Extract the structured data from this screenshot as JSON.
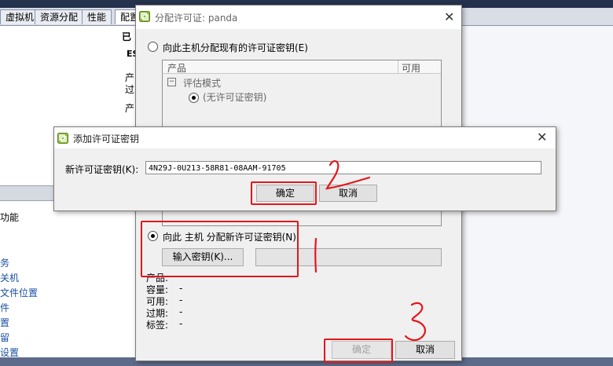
{
  "background": {
    "tabs": [
      "虚拟机",
      "资源分配",
      "性能",
      "配置"
    ],
    "right_header": "已",
    "frag_es": "ES",
    "frag_p1": "产",
    "frag_p2": "过",
    "frag_p3": "产",
    "left_heading": "功能",
    "left_links": [
      "务",
      "关机",
      "文件位置",
      "件",
      "置",
      "留",
      "设置"
    ]
  },
  "license_dialog": {
    "title": "分配许可证: panda",
    "option_existing": "向此主机分配现有的许可证密钥(E)",
    "table_headers": [
      "产品",
      "可用"
    ],
    "tree_node": "评估模式",
    "tree_child": "(无许可证密钥)",
    "option_new": "向此 主机 分配新许可证密钥(N)",
    "enter_key_button": "输入密钥(K)...",
    "details_labels": [
      "产品:",
      "容量:",
      "可用:",
      "过期:",
      "标签:"
    ],
    "details_values": [
      "",
      "-",
      "-",
      "-",
      "-"
    ],
    "ok_button": "确定",
    "cancel_button": "取消"
  },
  "add_key_dialog": {
    "title": "添加许可证密钥",
    "field_label": "新许可证密钥(K):",
    "field_value": "4N29J-0U213-58R81-08AAM-91705",
    "ok_button": "确定",
    "cancel_button": "取消"
  },
  "annotations": {
    "mark1": "1",
    "mark2": "2",
    "mark3": "3",
    "color": "#e4161b"
  }
}
